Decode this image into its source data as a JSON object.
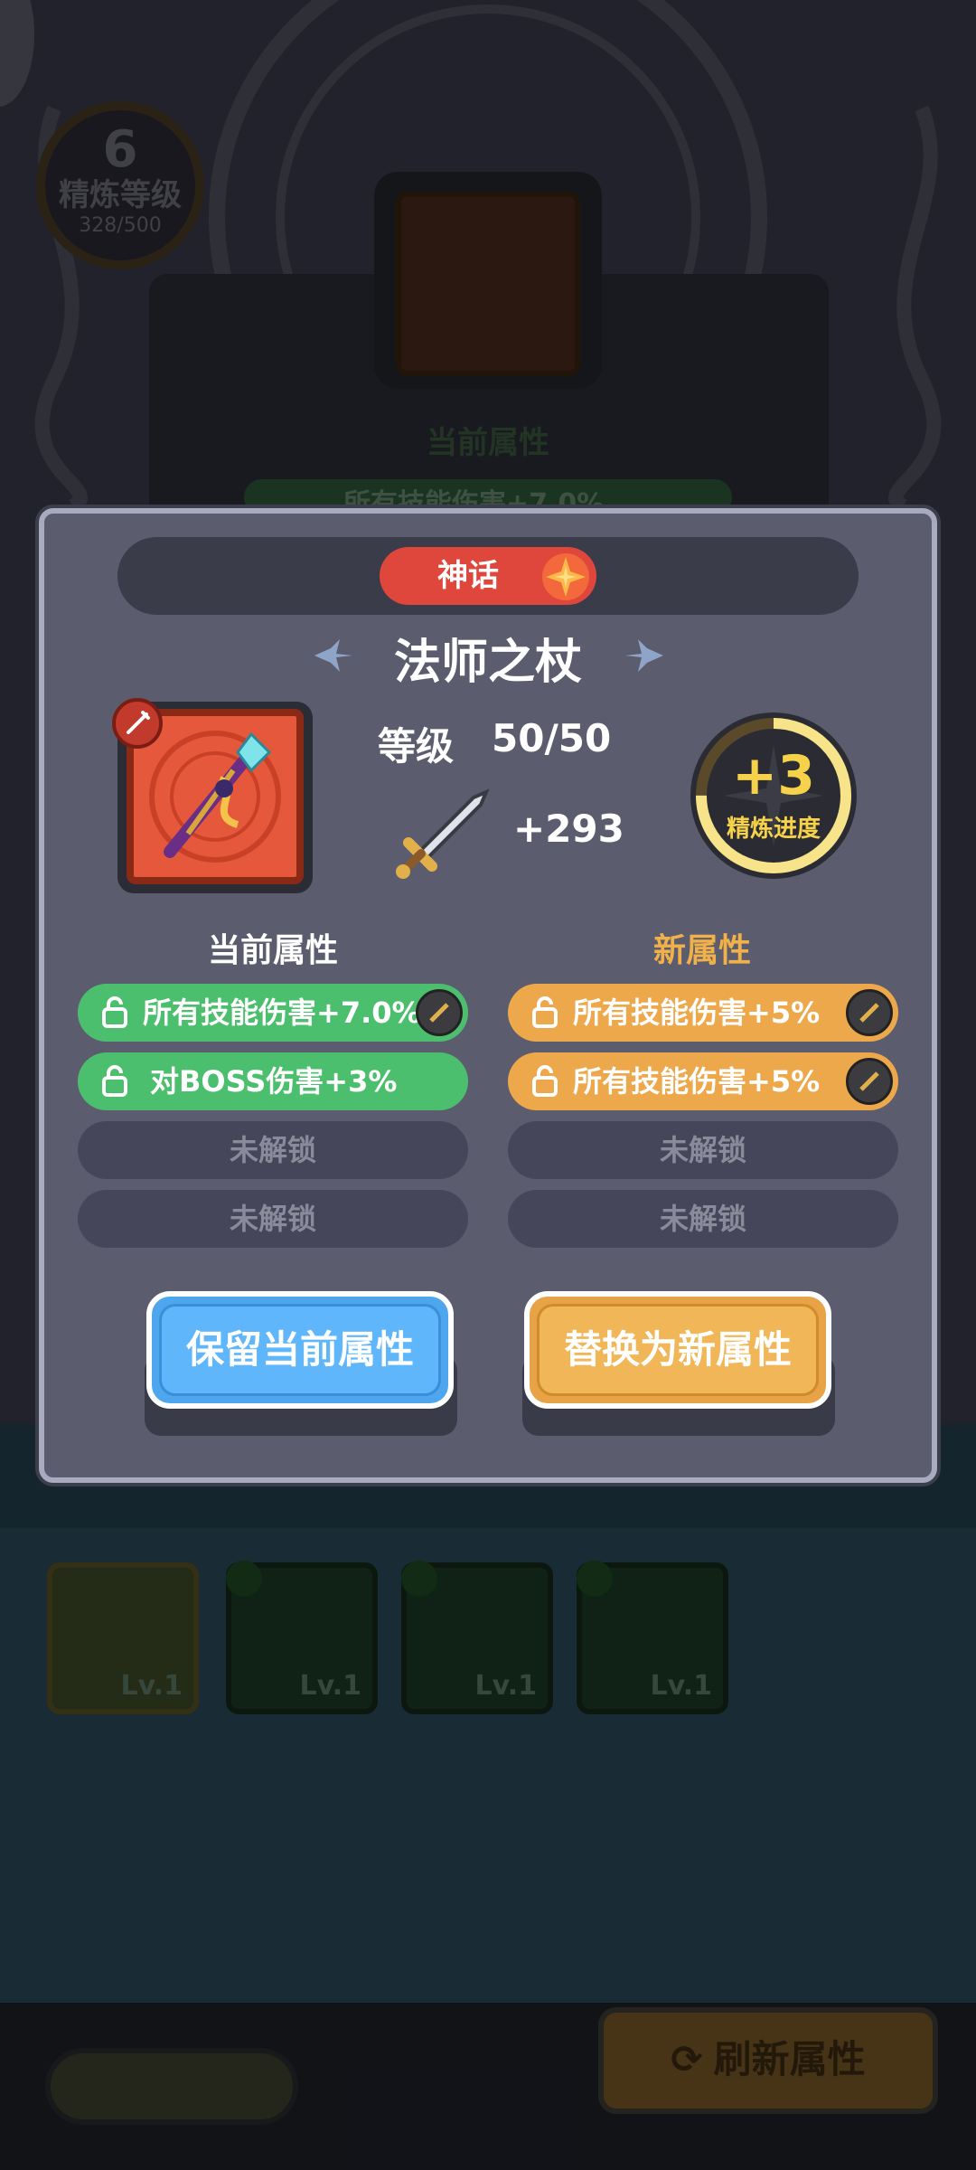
{
  "background": {
    "refine_level": "6",
    "refine_label": "精炼等级",
    "refine_count": "328/500",
    "current_attr_title": "当前属性",
    "current_attr_preview": "所有技能伤害+7.0%",
    "equipment_slots": [
      {
        "level": "Lv.1"
      },
      {
        "level": "Lv.1"
      },
      {
        "level": "Lv.1"
      },
      {
        "level": "Lv.1"
      }
    ],
    "refresh_button": "刷新属性"
  },
  "modal": {
    "rarity": "神话",
    "item_name": "法师之杖",
    "level_label": "等级",
    "level_value": "50/50",
    "power_bonus": "+293",
    "refine_progress_value": "+3",
    "refine_progress_label": "精炼进度",
    "refine_progress_fraction": 0.75,
    "current_title": "当前属性",
    "new_title": "新属性",
    "current_attrs": [
      {
        "text": "所有技能伤害+7.0%",
        "state": "unlocked"
      },
      {
        "text": "对BOSS伤害+3%",
        "state": "unlocked"
      },
      {
        "text": "未解锁",
        "state": "locked"
      },
      {
        "text": "未解锁",
        "state": "locked"
      }
    ],
    "new_attrs": [
      {
        "text": "所有技能伤害+5%",
        "state": "unlocked"
      },
      {
        "text": "所有技能伤害+5%",
        "state": "unlocked"
      },
      {
        "text": "未解锁",
        "state": "locked"
      },
      {
        "text": "未解锁",
        "state": "locked"
      }
    ],
    "keep_button": "保留当前属性",
    "replace_button": "替换为新属性"
  },
  "colors": {
    "rarity_red": "#e0473c",
    "attr_green": "#4cbf6e",
    "attr_orange": "#eea84c",
    "keep_blue": "#5fb6fa",
    "replace_orange": "#f0b657",
    "progress_gold": "#f6d14a"
  }
}
